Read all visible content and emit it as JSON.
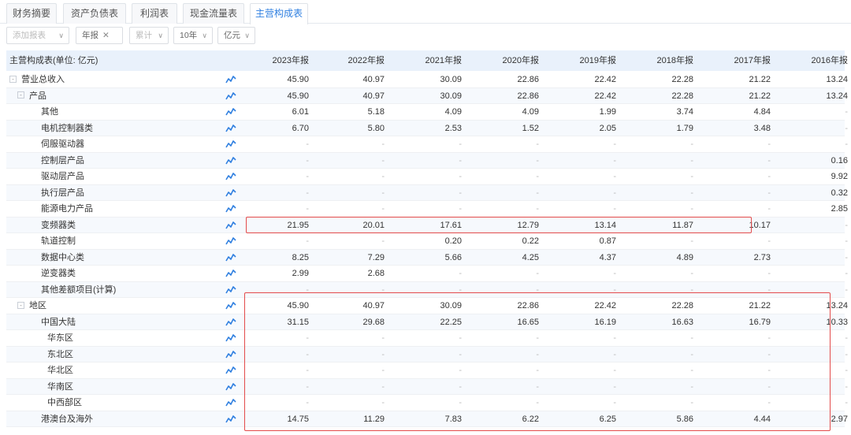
{
  "tabs": [
    {
      "label": "财务摘要"
    },
    {
      "label": "资产负债表"
    },
    {
      "label": "利润表"
    },
    {
      "label": "现金流量表"
    },
    {
      "label": "主营构成表"
    }
  ],
  "filters": {
    "add_report": "添加报表",
    "annual": "年报",
    "cumulative": "累计",
    "period": "10年",
    "unit": "亿元"
  },
  "table": {
    "header_label": "主营构成表(单位: 亿元)",
    "years": [
      "2023年报",
      "2022年报",
      "2021年报",
      "2020年报",
      "2019年报",
      "2018年报",
      "2017年报",
      "2016年报"
    ],
    "rows": [
      {
        "label": "营业总收入",
        "toggle": "-",
        "values": [
          "45.90",
          "40.97",
          "30.09",
          "22.86",
          "22.42",
          "22.28",
          "21.22",
          "13.24"
        ]
      },
      {
        "label": "产品",
        "toggle": "-",
        "values": [
          "45.90",
          "40.97",
          "30.09",
          "22.86",
          "22.42",
          "22.28",
          "21.22",
          "13.24"
        ]
      },
      {
        "label": "其他",
        "values": [
          "6.01",
          "5.18",
          "4.09",
          "4.09",
          "1.99",
          "3.74",
          "4.84",
          "-"
        ]
      },
      {
        "label": "电机控制器类",
        "values": [
          "6.70",
          "5.80",
          "2.53",
          "1.52",
          "2.05",
          "1.79",
          "3.48",
          "-"
        ]
      },
      {
        "label": "伺服驱动器",
        "values": [
          "-",
          "-",
          "-",
          "-",
          "-",
          "-",
          "-",
          "-"
        ]
      },
      {
        "label": "控制层产品",
        "values": [
          "-",
          "-",
          "-",
          "-",
          "-",
          "-",
          "-",
          "0.16"
        ]
      },
      {
        "label": "驱动层产品",
        "values": [
          "-",
          "-",
          "-",
          "-",
          "-",
          "-",
          "-",
          "9.92"
        ]
      },
      {
        "label": "执行层产品",
        "values": [
          "-",
          "-",
          "-",
          "-",
          "-",
          "-",
          "-",
          "0.32"
        ]
      },
      {
        "label": "能源电力产品",
        "values": [
          "-",
          "-",
          "-",
          "-",
          "-",
          "-",
          "-",
          "2.85"
        ]
      },
      {
        "label": "变频器类",
        "values": [
          "21.95",
          "20.01",
          "17.61",
          "12.79",
          "13.14",
          "11.87",
          "10.17",
          "-"
        ]
      },
      {
        "label": "轨道控制",
        "values": [
          "-",
          "-",
          "0.20",
          "0.22",
          "0.87",
          "-",
          "-",
          "-"
        ]
      },
      {
        "label": "数据中心类",
        "values": [
          "8.25",
          "7.29",
          "5.66",
          "4.25",
          "4.37",
          "4.89",
          "2.73",
          "-"
        ]
      },
      {
        "label": "逆变器类",
        "values": [
          "2.99",
          "2.68",
          "-",
          "-",
          "-",
          "-",
          "-",
          "-"
        ]
      },
      {
        "label": "其他差额项目(计算)",
        "values": [
          "-",
          "-",
          "-",
          "-",
          "-",
          "-",
          "-",
          "-"
        ]
      },
      {
        "label": "地区",
        "toggle": "-",
        "values": [
          "45.90",
          "40.97",
          "30.09",
          "22.86",
          "22.42",
          "22.28",
          "21.22",
          "13.24"
        ]
      },
      {
        "label": "中国大陆",
        "values": [
          "31.15",
          "29.68",
          "22.25",
          "16.65",
          "16.19",
          "16.63",
          "16.79",
          "10.33"
        ]
      },
      {
        "label": "华东区",
        "values": [
          "-",
          "-",
          "-",
          "-",
          "-",
          "-",
          "-",
          "-"
        ]
      },
      {
        "label": "东北区",
        "values": [
          "-",
          "-",
          "-",
          "-",
          "-",
          "-",
          "-",
          "-"
        ]
      },
      {
        "label": "华北区",
        "values": [
          "-",
          "-",
          "-",
          "-",
          "-",
          "-",
          "-",
          "-"
        ]
      },
      {
        "label": "华南区",
        "values": [
          "-",
          "-",
          "-",
          "-",
          "-",
          "-",
          "-",
          "-"
        ]
      },
      {
        "label": "中西部区",
        "values": [
          "-",
          "-",
          "-",
          "-",
          "-",
          "-",
          "-",
          "-"
        ]
      },
      {
        "label": "港澳台及海外",
        "values": [
          "14.75",
          "11.29",
          "7.83",
          "6.22",
          "6.25",
          "5.86",
          "4.44",
          "2.97"
        ]
      }
    ]
  },
  "colors": {
    "accent": "#2f7fe0",
    "header_bg": "#e9f1fb",
    "highlight": "#e34b4b"
  },
  "icons": {
    "trend": "trend-line-icon",
    "dropdown": "chevron-down-icon",
    "close": "close-icon"
  }
}
